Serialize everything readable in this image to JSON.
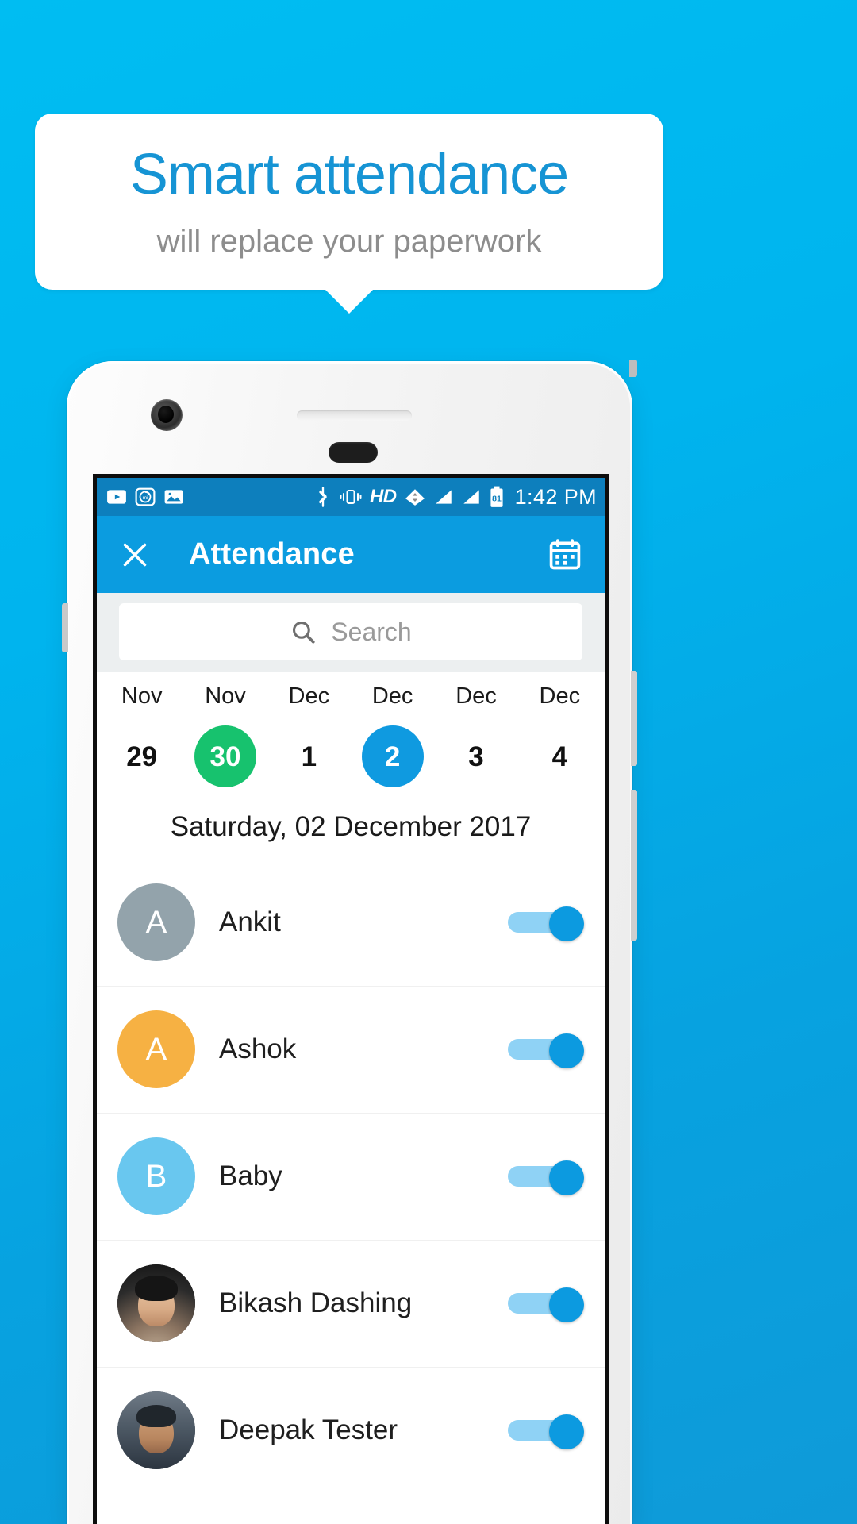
{
  "promo": {
    "title": "Smart attendance",
    "subtitle": "will replace your paperwork",
    "title_color": "#1694d4",
    "subtitle_color": "#8d8d8d",
    "background_color": "#00b4ee"
  },
  "status_bar": {
    "time": "1:42 PM",
    "battery_level": "81",
    "left_icons": [
      "youtube-play-icon",
      "mi-sync-icon",
      "gallery-image-icon"
    ],
    "right_icons": [
      "bluetooth-icon",
      "vibrate-icon",
      "hd-voice-icon",
      "wifi-icon",
      "signal-sim1-icon",
      "signal-sim2-icon",
      "battery-icon"
    ],
    "hd_label": "HD",
    "background_color": "#0d7fbd"
  },
  "app_bar": {
    "close_icon": "close-icon",
    "title": "Attendance",
    "calendar_icon": "calendar-icon",
    "background_color": "#0b9ce0"
  },
  "search": {
    "placeholder": "Search",
    "value": "",
    "icon": "search-icon"
  },
  "date_strip": [
    {
      "month": "Nov",
      "day": "29",
      "state": "normal"
    },
    {
      "month": "Nov",
      "day": "30",
      "state": "green"
    },
    {
      "month": "Dec",
      "day": "1",
      "state": "normal"
    },
    {
      "month": "Dec",
      "day": "2",
      "state": "blue"
    },
    {
      "month": "Dec",
      "day": "3",
      "state": "normal"
    },
    {
      "month": "Dec",
      "day": "4",
      "state": "normal"
    }
  ],
  "selected_date_label": "Saturday, 02 December 2017",
  "colors": {
    "accent_green": "#17c26e",
    "accent_blue": "#0f9ae0",
    "toggle_track": "#8fd2f5",
    "toggle_knob": "#0c9ae0"
  },
  "attendance_list": [
    {
      "name": "Ankit",
      "initial": "A",
      "avatar_type": "initial",
      "avatar_color": "#93a3ab",
      "toggle_on": true
    },
    {
      "name": "Ashok",
      "initial": "A",
      "avatar_type": "initial",
      "avatar_color": "#f6b143",
      "toggle_on": true
    },
    {
      "name": "Baby",
      "initial": "B",
      "avatar_type": "initial",
      "avatar_color": "#69c7ef",
      "toggle_on": true
    },
    {
      "name": "Bikash Dashing",
      "initial": "",
      "avatar_type": "photo-a",
      "avatar_color": "#1e1e1e",
      "toggle_on": true
    },
    {
      "name": "Deepak Tester",
      "initial": "",
      "avatar_type": "photo-b",
      "avatar_color": "#46525e",
      "toggle_on": true
    }
  ]
}
